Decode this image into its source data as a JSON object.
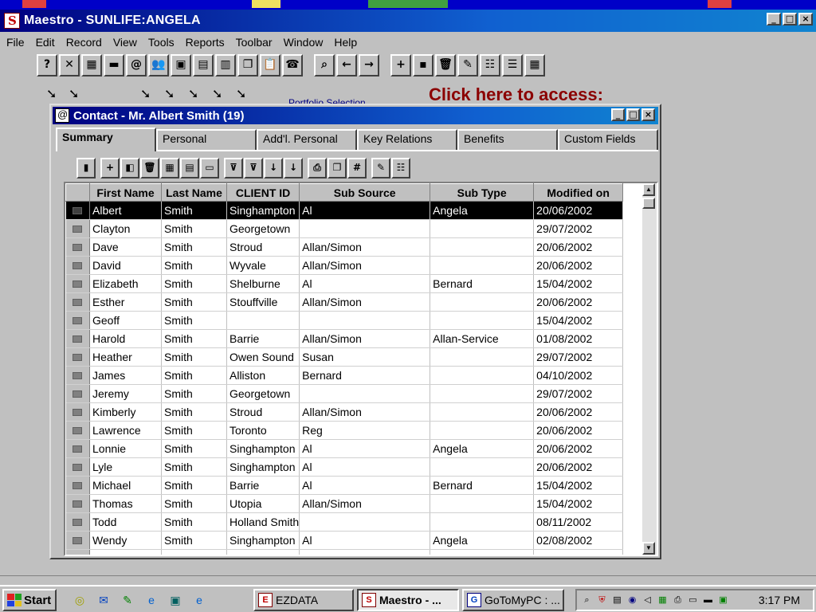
{
  "main_window": {
    "title": "Maestro - SUNLIFE:ANGELA"
  },
  "menu": [
    "File",
    "Edit",
    "Record",
    "View",
    "Tools",
    "Reports",
    "Toolbar",
    "Window",
    "Help"
  ],
  "main_toolbar": [
    {
      "icon": "help-icon",
      "glyph": "?"
    },
    {
      "icon": "close-record-icon",
      "glyph": "✕"
    },
    {
      "icon": "calculator-icon",
      "glyph": "▦"
    },
    {
      "icon": "minus-icon",
      "glyph": "▬"
    },
    {
      "icon": "globe-icon",
      "glyph": "@"
    },
    {
      "icon": "contacts-icon",
      "glyph": "👥"
    },
    {
      "icon": "book-icon",
      "glyph": "▣"
    },
    {
      "icon": "calendar-icon",
      "glyph": "▤"
    },
    {
      "icon": "list-icon",
      "glyph": "▥"
    },
    {
      "icon": "copy-icon",
      "glyph": "❐"
    },
    {
      "icon": "paste-icon",
      "glyph": "📋"
    },
    {
      "icon": "phone-icon",
      "glyph": "☎"
    },
    {
      "icon": "binoculars-icon",
      "glyph": "⌕"
    },
    {
      "icon": "arrow-left-icon",
      "glyph": "←"
    },
    {
      "icon": "arrow-right-icon",
      "glyph": "→"
    },
    {
      "icon": "add-icon",
      "glyph": "+"
    },
    {
      "icon": "save-icon",
      "glyph": "▪"
    },
    {
      "icon": "delete-icon",
      "glyph": "🗑"
    },
    {
      "icon": "edit-icon",
      "glyph": "✎"
    },
    {
      "icon": "columns-icon",
      "glyph": "☷"
    },
    {
      "icon": "form-icon",
      "glyph": "☰"
    },
    {
      "icon": "grid-icon",
      "glyph": "▦"
    }
  ],
  "background_links": {
    "access": "Click here to access:",
    "filter": "Portfolio Selection"
  },
  "contact_window": {
    "title": "Contact - Mr. Albert Smith (19)",
    "tabs": [
      "Summary",
      "Personal",
      "Add'l. Personal",
      "Key Relations",
      "Benefits",
      "Custom Fields"
    ],
    "active_tab": "Summary",
    "toolbar": [
      {
        "icon": "blank-icon",
        "glyph": "▮"
      },
      {
        "icon": "add-icon",
        "glyph": "+"
      },
      {
        "icon": "color-icon",
        "glyph": "◧"
      },
      {
        "icon": "delete-icon",
        "glyph": "🗑"
      },
      {
        "icon": "tile-icon",
        "glyph": "▦"
      },
      {
        "icon": "report-icon",
        "glyph": "▤"
      },
      {
        "icon": "label-icon",
        "glyph": "▭"
      },
      {
        "icon": "filter-icon",
        "glyph": "⊽"
      },
      {
        "icon": "clear-filter-icon",
        "glyph": "⊽"
      },
      {
        "icon": "sort-asc-icon",
        "glyph": "↓"
      },
      {
        "icon": "sort-desc-icon",
        "glyph": "↓"
      },
      {
        "icon": "print-icon",
        "glyph": "⎙"
      },
      {
        "icon": "copy-icon",
        "glyph": "❐"
      },
      {
        "icon": "grid-icon",
        "glyph": "#"
      },
      {
        "icon": "edit-icon",
        "glyph": "✎"
      },
      {
        "icon": "columns-icon",
        "glyph": "☷"
      }
    ],
    "columns": [
      "First Name",
      "Last Name",
      "CLIENT ID",
      "Sub Source",
      "Sub Type",
      "Modified on"
    ],
    "rows": [
      [
        "Albert",
        "Smith",
        "Singhampton",
        "Al",
        "Angela",
        "20/06/2002"
      ],
      [
        "Clayton",
        "Smith",
        "Georgetown",
        "",
        "",
        "29/07/2002"
      ],
      [
        "Dave",
        "Smith",
        "Stroud",
        "Allan/Simon",
        "",
        "20/06/2002"
      ],
      [
        "David",
        "Smith",
        "Wyvale",
        "Allan/Simon",
        "",
        "20/06/2002"
      ],
      [
        "Elizabeth",
        "Smith",
        "Shelburne",
        "Al",
        "Bernard",
        "15/04/2002"
      ],
      [
        "Esther",
        "Smith",
        "Stouffville",
        "Allan/Simon",
        "",
        "20/06/2002"
      ],
      [
        "Geoff",
        "Smith",
        "",
        "",
        "",
        "15/04/2002"
      ],
      [
        "Harold",
        "Smith",
        "Barrie",
        "Allan/Simon",
        "Allan-Service",
        "01/08/2002"
      ],
      [
        "Heather",
        "Smith",
        "Owen Sound",
        "Susan",
        "",
        "29/07/2002"
      ],
      [
        "James",
        "Smith",
        "Alliston",
        "Bernard",
        "",
        "04/10/2002"
      ],
      [
        "Jeremy",
        "Smith",
        "Georgetown",
        "",
        "",
        "29/07/2002"
      ],
      [
        "Kimberly",
        "Smith",
        "Stroud",
        "Allan/Simon",
        "",
        "20/06/2002"
      ],
      [
        "Lawrence",
        "Smith",
        "Toronto",
        "Reg",
        "",
        "20/06/2002"
      ],
      [
        "Lonnie",
        "Smith",
        "Singhampton",
        "Al",
        "Angela",
        "20/06/2002"
      ],
      [
        "Lyle",
        "Smith",
        "Singhampton",
        "Al",
        "",
        "20/06/2002"
      ],
      [
        "Michael",
        "Smith",
        "Barrie",
        "Al",
        "Bernard",
        "15/04/2002"
      ],
      [
        "Thomas",
        "Smith",
        "Utopia",
        "Allan/Simon",
        "",
        "15/04/2002"
      ],
      [
        "Todd",
        "Smith",
        "Holland Smith",
        "",
        "",
        "08/11/2002"
      ],
      [
        "Wendy",
        "Smith",
        "Singhampton",
        "Al",
        "Angela",
        "02/08/2002"
      ],
      [
        "",
        "",
        "",
        "",
        "",
        ""
      ]
    ],
    "selected_row": 0
  },
  "taskbar": {
    "start_label": "Start",
    "tasks": [
      {
        "label": "EZDATA",
        "active": false
      },
      {
        "label": "Maestro - ...",
        "active": true
      },
      {
        "label": "GoToMyPC : ...",
        "active": false
      }
    ],
    "clock": "3:17 PM"
  },
  "colors": {
    "title_gradient_start": "#000080",
    "title_gradient_end": "#1084d0",
    "link_red": "#8b0000",
    "face": "#c0c0c0"
  }
}
